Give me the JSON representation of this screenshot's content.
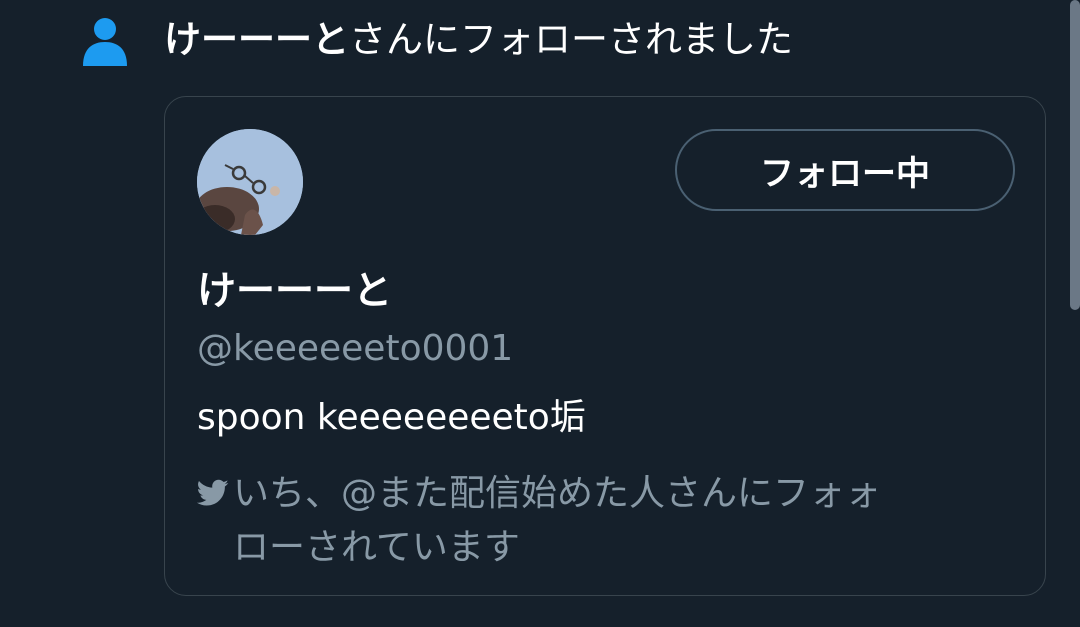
{
  "notification": {
    "icon": "person-icon",
    "actor_name": "けーーーと",
    "action_text": "さんにフォローされました",
    "accent_color": "#1d9bf0"
  },
  "user_card": {
    "display_name": "けーーーと",
    "handle": "@keeeeeeto0001",
    "bio": "spoon keeeeeeeeto垢",
    "follow_button_label": "フォロー中",
    "social_context_line1": "いち、@また配信始めた人さんにフォォ",
    "social_context_line2": "ローされています",
    "social_context_icon": "twitter-bird-icon"
  },
  "colors": {
    "background": "#15202b",
    "border": "#38444d",
    "secondary_text": "#8899a6"
  }
}
